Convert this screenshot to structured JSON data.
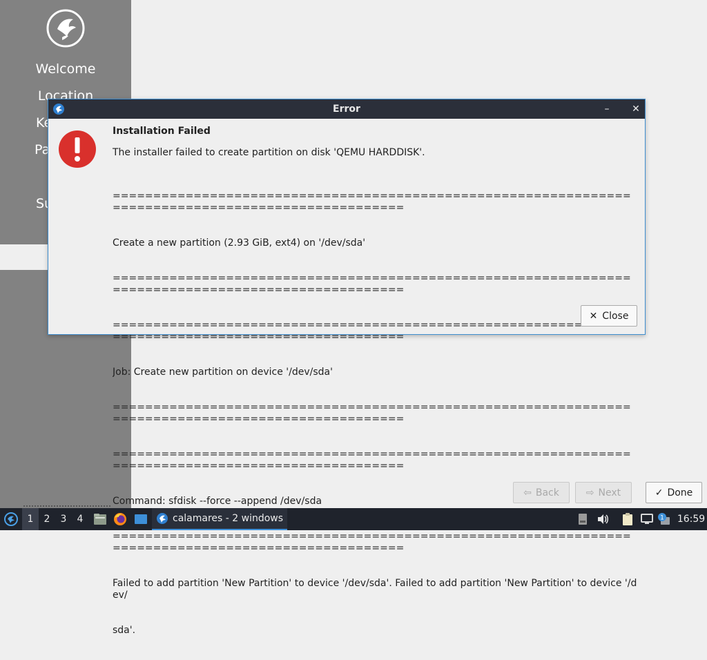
{
  "installer": {
    "sidebar": {
      "items": [
        {
          "label": "Welcome"
        },
        {
          "label": "Location"
        },
        {
          "label": "Ke"
        },
        {
          "label": "Pa"
        },
        {
          "label": "Su"
        }
      ]
    },
    "nav": {
      "back_label": "Back",
      "next_label": "Next",
      "done_label": "Done"
    }
  },
  "dialog": {
    "title": "Error",
    "heading": "Installation Failed",
    "summary": "The installer failed to create partition on disk 'QEMU HARDDISK'.",
    "details": [
      "====================================================================================================",
      "Create a new partition (2.93 GiB, ext4) on '/dev/sda'",
      "====================================================================================================",
      "====================================================================================================",
      "Job: Create new partition on device '/dev/sda'",
      "====================================================================================================",
      "====================================================================================================",
      "Command: sfdisk --force --append /dev/sda",
      "====================================================================================================",
      "Failed to add partition 'New Partition' to device '/dev/sda'. Failed to add partition 'New Partition' to device '/dev/",
      "sda'."
    ],
    "close_label": "Close",
    "minimize_glyph": "–",
    "close_glyph": "✕"
  },
  "taskbar": {
    "workspaces": [
      "1",
      "2",
      "3",
      "4"
    ],
    "active_workspace": "1",
    "task_label": "calamares - 2 windows",
    "clock": "16:59",
    "notification_count": "1"
  },
  "colors": {
    "sidebar_bg": "#828282",
    "titlebar_bg": "#2b2f3a",
    "dialog_border": "#3e8ed0",
    "error_red": "#d9302c",
    "taskbar_bg": "#1f232c",
    "accent_blue": "#3d8fd8"
  }
}
